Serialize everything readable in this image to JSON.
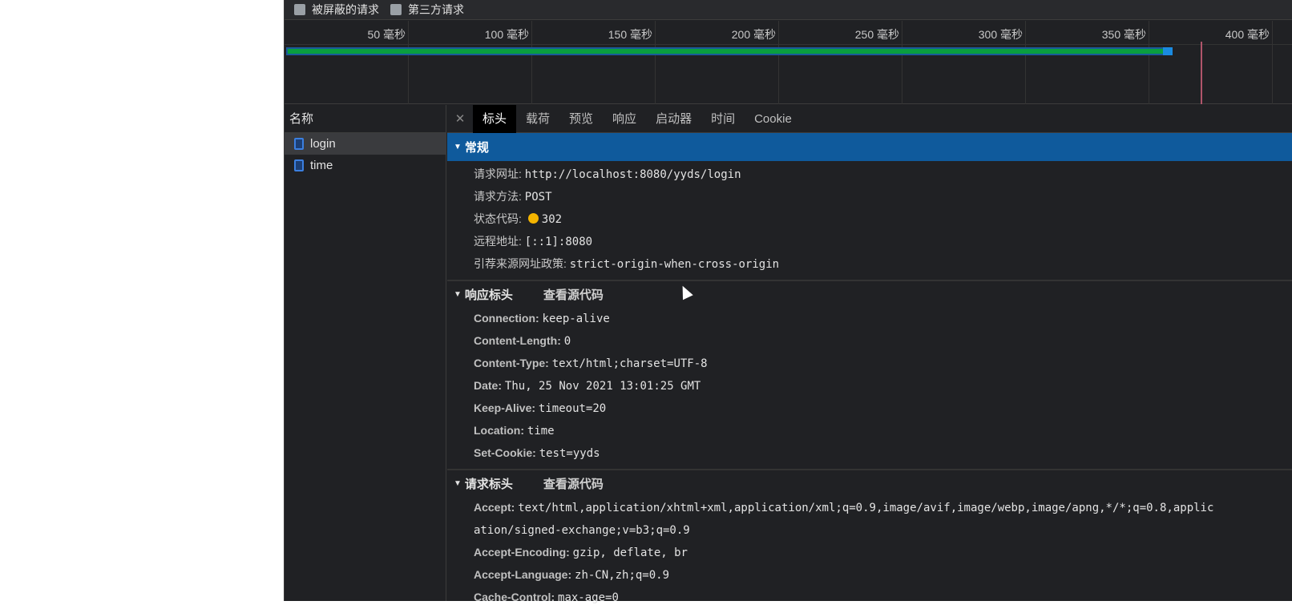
{
  "filters": [
    {
      "label": "被屏蔽的请求"
    },
    {
      "label": "第三方请求"
    }
  ],
  "timeline": {
    "ticks": [
      "50 毫秒",
      "100 毫秒",
      "150 毫秒",
      "200 毫秒",
      "250 毫秒",
      "300 毫秒",
      "350 毫秒",
      "400 毫秒"
    ],
    "request_end_ms": 359,
    "load_event_ms": 371,
    "bar_color": "#0a9e40",
    "marker_color": "#b0556a"
  },
  "names": {
    "header": "名称",
    "items": [
      {
        "label": "login"
      },
      {
        "label": "time"
      }
    ]
  },
  "tabs": [
    "标头",
    "载荷",
    "预览",
    "响应",
    "启动器",
    "时间",
    "Cookie"
  ],
  "general": {
    "title": "常规",
    "rows": [
      {
        "key": "请求网址:",
        "value": "http://localhost:8080/yyds/login"
      },
      {
        "key": "请求方法:",
        "value": "POST"
      },
      {
        "key": "状态代码:",
        "value": "302"
      },
      {
        "key": "远程地址:",
        "value": "[::1]:8080"
      },
      {
        "key": "引荐来源网址政策:",
        "value": "strict-origin-when-cross-origin"
      }
    ]
  },
  "response": {
    "title": "响应标头",
    "view_source": "查看源代码",
    "rows": [
      {
        "key": "Connection:",
        "value": "keep-alive"
      },
      {
        "key": "Content-Length:",
        "value": "0"
      },
      {
        "key": "Content-Type:",
        "value": "text/html;charset=UTF-8"
      },
      {
        "key": "Date:",
        "value": "Thu, 25 Nov 2021 13:01:25 GMT"
      },
      {
        "key": "Keep-Alive:",
        "value": "timeout=20"
      },
      {
        "key": "Location:",
        "value": "time"
      },
      {
        "key": "Set-Cookie:",
        "value": "test=yyds"
      }
    ]
  },
  "request": {
    "title": "请求标头",
    "view_source": "查看源代码",
    "rows": [
      {
        "key": "Accept:",
        "value": "text/html,application/xhtml+xml,application/xml;q=0.9,image/avif,image/webp,image/apng,*/*;q=0.8,applic",
        "cont": "ation/signed-exchange;v=b3;q=0.9"
      },
      {
        "key": "Accept-Encoding:",
        "value": "gzip, deflate, br"
      },
      {
        "key": "Accept-Language:",
        "value": "zh-CN,zh;q=0.9"
      },
      {
        "key": "Cache-Control:",
        "value": "max-age=0"
      }
    ]
  }
}
